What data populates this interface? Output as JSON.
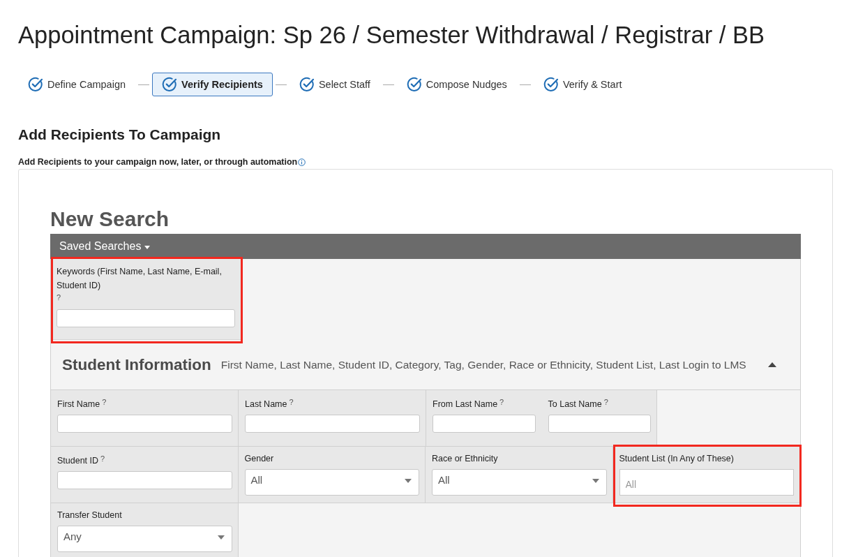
{
  "page": {
    "title": "Appointment Campaign: Sp 26 / Semester Withdrawal / Registrar / BB"
  },
  "steps": [
    {
      "label": "Define Campaign",
      "completed": true,
      "selected": false
    },
    {
      "label": "Verify Recipients",
      "completed": true,
      "selected": true
    },
    {
      "label": "Select Staff",
      "completed": true,
      "selected": false
    },
    {
      "label": "Compose Nudges",
      "completed": true,
      "selected": false
    },
    {
      "label": "Verify & Start",
      "completed": true,
      "selected": false
    }
  ],
  "section": {
    "heading": "Add Recipients To Campaign",
    "description": "Add Recipients to your campaign now, later, or through automation"
  },
  "search": {
    "title": "New Search",
    "saved_searches": "Saved Searches",
    "keywords": {
      "label": "Keywords (First Name, Last Name, E-mail, Student ID)",
      "help": "?",
      "highlighted": true
    },
    "student_information": {
      "title": "Student Information",
      "summary": "First Name, Last Name, Student ID, Category, Tag, Gender, Race or Ethnicity, Student List, Last Login to LMS",
      "expanded": true,
      "rows": [
        {
          "cells": [
            {
              "kind": "text",
              "label": "First Name",
              "help": "?",
              "highlighted": false
            },
            {
              "kind": "text",
              "label": "Last Name",
              "help": "?",
              "highlighted": false
            },
            {
              "kind": "pair",
              "highlighted": false,
              "fields": [
                {
                  "kind": "text",
                  "label": "From Last Name",
                  "help": "?"
                },
                {
                  "kind": "text",
                  "label": "To Last Name",
                  "help": "?"
                }
              ]
            }
          ]
        },
        {
          "cells": [
            {
              "kind": "text",
              "label": "Student ID",
              "help": "?",
              "highlighted": false
            },
            {
              "kind": "select",
              "label": "Gender",
              "value": "All",
              "highlighted": false
            },
            {
              "kind": "select",
              "label": "Race or Ethnicity",
              "value": "All",
              "highlighted": false
            },
            {
              "kind": "multiselect",
              "label": "Student List (In Any of These)",
              "placeholder": "All",
              "highlighted": true
            }
          ]
        },
        {
          "cells": [
            {
              "kind": "select",
              "label": "Transfer Student",
              "value": "Any",
              "highlighted": false
            }
          ]
        }
      ]
    }
  }
}
